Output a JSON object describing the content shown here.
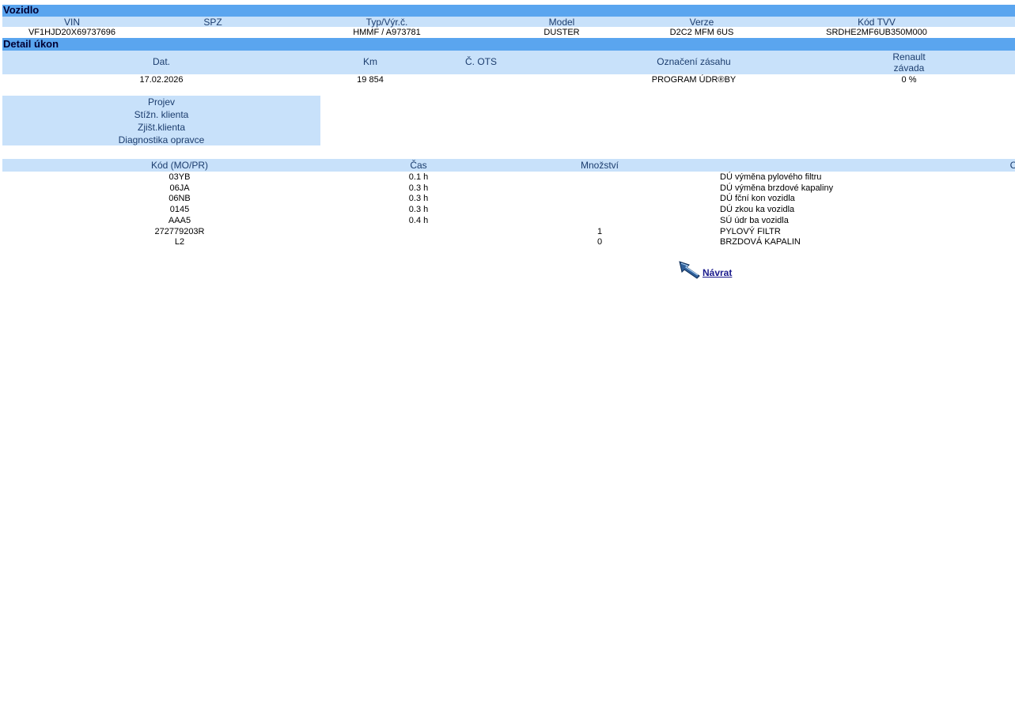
{
  "vehicle": {
    "section_title": "Vozidlo",
    "headers": {
      "vin": "VIN",
      "spz": "SPZ",
      "typ": "Typ/Výr.č.",
      "model": "Model",
      "verze": "Verze",
      "kod_tvv": "Kód TVV"
    },
    "values": {
      "vin": "VF1HJD20X69737696",
      "spz": "",
      "typ": "HMMF / A973781",
      "model": "DUSTER",
      "verze": "D2C2 MFM 6US",
      "kod_tvv": "SRDHE2MF6UB350M000"
    }
  },
  "detail": {
    "section_title": "Detail úkon",
    "headers": {
      "dat": "Dat.",
      "km": "Km",
      "ots": "Č. OTS",
      "oznaceni": "Označení zásahu",
      "renault_line1": "Renault",
      "renault_line2": "závada"
    },
    "values": {
      "dat": "17.02.2026",
      "km": "19 854",
      "ots": "",
      "oznaceni": "PROGRAM ÚDR®BY",
      "renault": "0 %"
    }
  },
  "side_panel": {
    "items": [
      "Projev",
      "Stížn. klienta",
      "Zjišt.klienta",
      "Diagnostika opravce"
    ]
  },
  "operations": {
    "headers": {
      "kod": "Kód (MO/PR)",
      "cas": "Čas",
      "mnozstvi": "Množství",
      "cut": "C"
    },
    "rows": [
      {
        "kod": "03YB",
        "cas": "0.1 h",
        "mnozstvi": "",
        "popis": "DÚ výměna pylového filtru"
      },
      {
        "kod": "06JA",
        "cas": "0.3 h",
        "mnozstvi": "",
        "popis": "DÚ výměna brzdové kapaliny"
      },
      {
        "kod": "06NB",
        "cas": "0.3 h",
        "mnozstvi": "",
        "popis": "DÚ fční kon vozidla"
      },
      {
        "kod": "0145",
        "cas": "0.3 h",
        "mnozstvi": "",
        "popis": "DÚ zkou ka vozidla"
      },
      {
        "kod": "AAA5",
        "cas": "0.4 h",
        "mnozstvi": "",
        "popis": "SÚ údr ba vozidla"
      },
      {
        "kod": "272779203R",
        "cas": "",
        "mnozstvi": "1",
        "popis": "PYLOVÝ FILTR"
      },
      {
        "kod": "L2",
        "cas": "",
        "mnozstvi": "0",
        "popis": "BRZDOVÁ KAPALIN"
      }
    ]
  },
  "back_link": {
    "label": "Návrat",
    "icon": "back-arrow-icon"
  },
  "colors": {
    "section_bar": "#5aa5ef",
    "header_bar": "#c8e1fa",
    "header_text": "#1c3d6e",
    "link": "#1a1a8c"
  }
}
